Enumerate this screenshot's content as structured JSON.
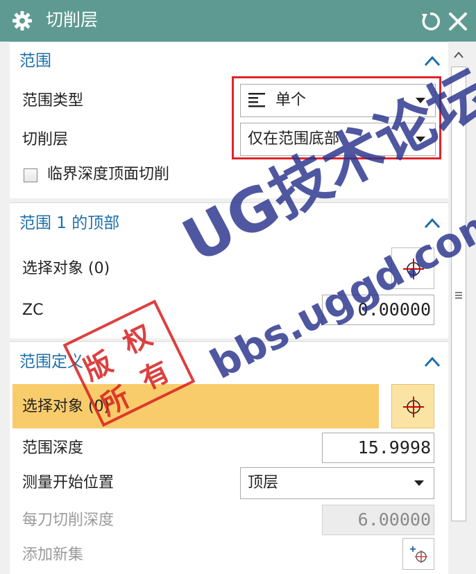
{
  "window": {
    "title": "切削层"
  },
  "range_section": {
    "header": "范围",
    "range_type_label": "范围类型",
    "range_type_value": "单个",
    "cut_level_label": "切削层",
    "cut_level_value": "仅在范围底部",
    "critical_depth_label": "临界深度顶面切削",
    "critical_depth_checked": false
  },
  "range_top_section": {
    "header": "范围 1 的顶部",
    "select_object_label": "选择对象 (0)",
    "zc_label": "ZC",
    "zc_value": "0.00000"
  },
  "range_def_section": {
    "header": "范围定义",
    "select_object_label": "选择对象 (0)",
    "depth_label": "范围深度",
    "depth_value": "15.9998",
    "measure_from_label": "测量开始位置",
    "measure_from_value": "顶层",
    "cut_depth_label": "每刀切削深度",
    "cut_depth_value": "6.00000",
    "add_set_label": "添加新集"
  },
  "watermark": {
    "title": "UG技术论坛",
    "url": "bbs.uggd.com",
    "stamp": [
      "版",
      "权",
      "所",
      "有"
    ]
  },
  "colors": {
    "titlebar": "#5e9a92",
    "header_text": "#1d6fa8",
    "highlight": "#f9cc6b",
    "red_box": "#e0242a"
  }
}
